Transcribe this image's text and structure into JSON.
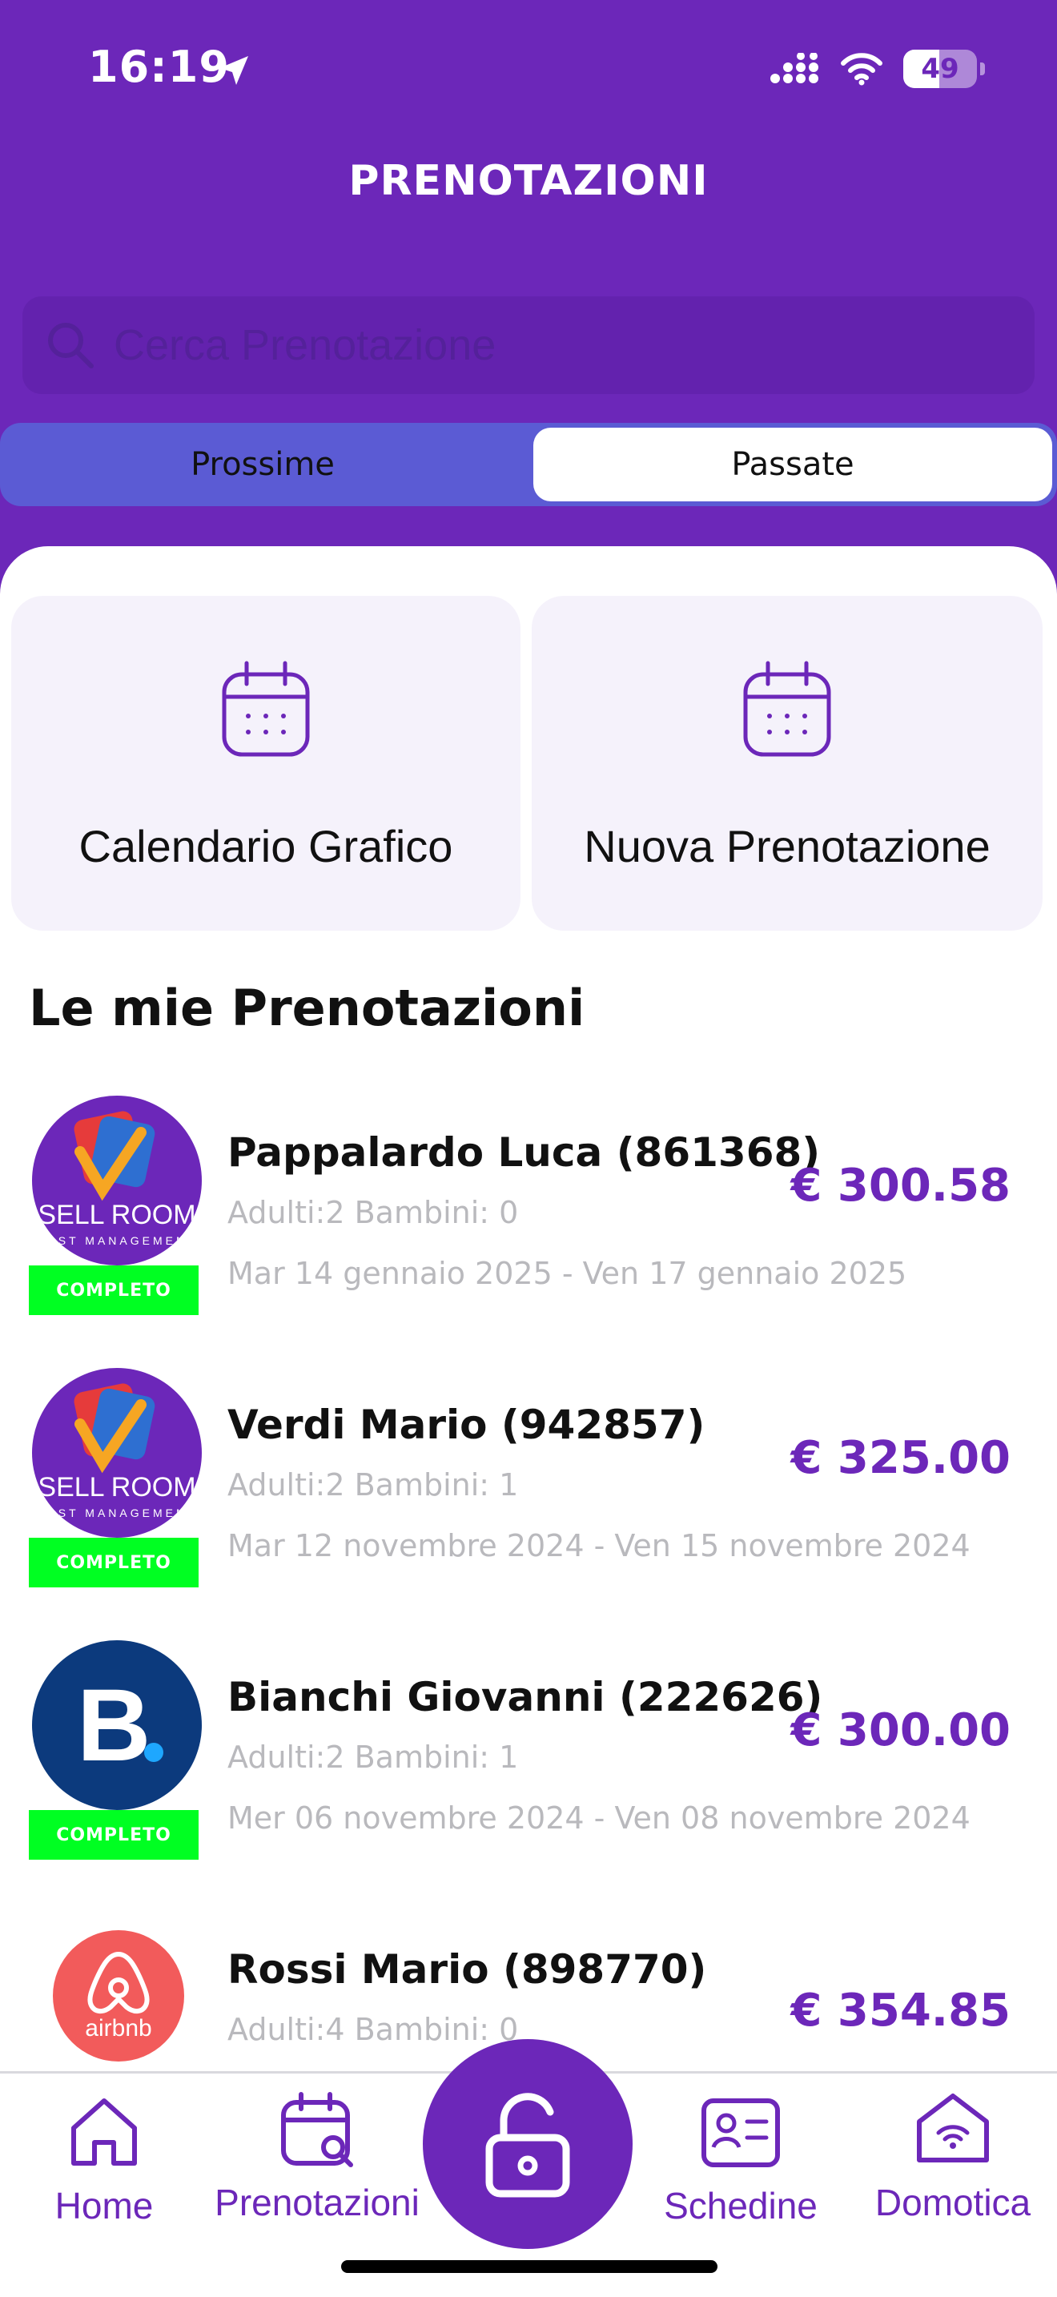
{
  "status_bar": {
    "time": "16:19",
    "battery_level": "49",
    "battery_fraction": 0.49
  },
  "header": {
    "title": "PRENOTAZIONI"
  },
  "search": {
    "placeholder": "Cerca Prenotazione",
    "value": ""
  },
  "segments": [
    {
      "label": "Prossime",
      "selected": false
    },
    {
      "label": "Passate",
      "selected": true
    }
  ],
  "actions": [
    {
      "label": "Calendario Grafico",
      "icon": "calendar-icon"
    },
    {
      "label": "Nuova Prenotazione",
      "icon": "calendar-icon"
    }
  ],
  "section_title": "Le mie Prenotazioni",
  "bookings": [
    {
      "name": "Pappalardo Luca (861368)",
      "guests": "Adulti:2 Bambini: 0",
      "dates": "Mar 14 gennaio 2025 - Ven 17 gennaio 2025",
      "price": "€ 300.58",
      "status": "COMPLETO",
      "logo": "sell-room",
      "logo_text": "SELL ROOM",
      "logo_subtext": "OST MANAGEMEN"
    },
    {
      "name": "Verdi Mario (942857)",
      "guests": "Adulti:2 Bambini: 1",
      "dates": "Mar 12 novembre 2024 - Ven 15 novembre 2024",
      "price": "€ 325.00",
      "status": "COMPLETO",
      "logo": "sell-room",
      "logo_text": "SELL ROOM",
      "logo_subtext": "OST MANAGEMEN"
    },
    {
      "name": "Bianchi Giovanni (222626)",
      "guests": "Adulti:2 Bambini: 1",
      "dates": "Mer 06 novembre 2024 - Ven 08 novembre 2024",
      "price": "€ 300.00",
      "status": "COMPLETO",
      "logo": "booking",
      "logo_text": "B"
    },
    {
      "name": "Rossi Mario (898770)",
      "guests": "Adulti:4 Bambini: 0",
      "dates": "",
      "price": "€ 354.85",
      "status": "",
      "logo": "airbnb",
      "logo_text": "airbnb"
    }
  ],
  "tabbar": {
    "items": [
      {
        "label": "Home",
        "icon": "home-icon"
      },
      {
        "label": "Prenotazioni",
        "icon": "calendar-search-icon"
      },
      {
        "label": "Schedine",
        "icon": "id-card-icon"
      },
      {
        "label": "Domotica",
        "icon": "smart-home-icon"
      }
    ],
    "center_icon": "unlock-icon"
  },
  "colors": {
    "primary": "#6c27b9",
    "segment_bg": "#5b5bd4",
    "badge": "#00ff22",
    "muted_text": "#b9b9bd"
  }
}
